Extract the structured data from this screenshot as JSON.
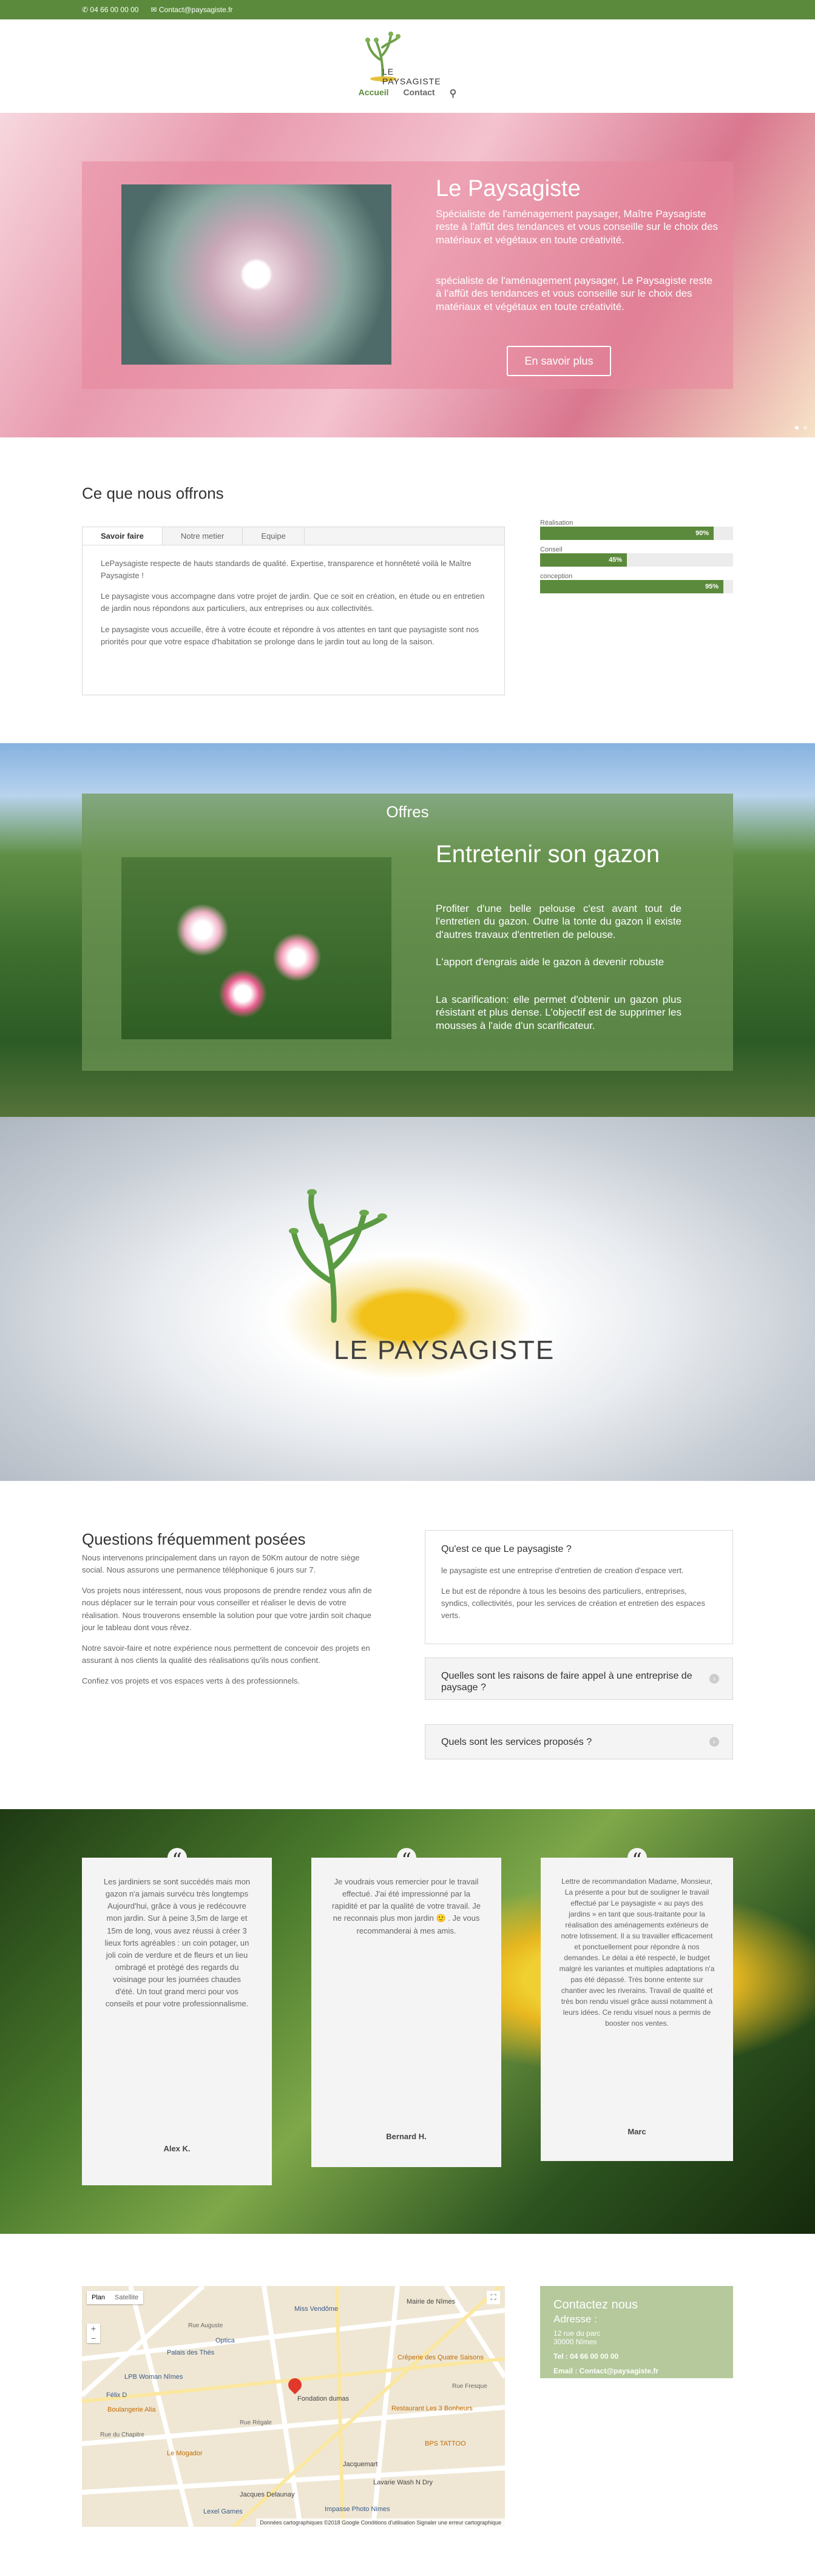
{
  "topbar": {
    "phone": "04 66 00 00 00",
    "email": "Contact@paysagiste.fr"
  },
  "logo": {
    "text": "LE PAYSAGISTE"
  },
  "nav": {
    "items": [
      "Accueil",
      "Contact"
    ]
  },
  "hero": {
    "title": "Le Paysagiste",
    "p1": "Spécialiste de l'aménagement paysager, Maître Paysagiste reste à l'affût des tendances et vous conseille sur le choix des matériaux et végétaux en toute créativité.",
    "p2": "spécialiste de l'aménagement paysager, Le Paysagiste reste à l'affût des tendances et vous conseille sur le choix des matériaux et végétaux en toute créativité.",
    "button": "En savoir plus"
  },
  "offer": {
    "title": "Ce que nous offrons",
    "tabs": [
      "Savoir faire",
      "Notre metier",
      "Equipe"
    ],
    "p1": "LePaysagiste respecte de hauts standards de qualité. Expertise, transparence et honnêteté voilà le Maître Paysagiste !",
    "p2": "Le paysagiste vous accompagne dans votre projet de jardin. Que ce soit en création, en étude ou en entretien de jardin nous répondons aux particuliers, aux entreprises ou aux collectivités.",
    "p3": "Le paysagiste vous accueille, être à votre écoute et répondre à vos attentes en tant que paysagiste sont nos priorités pour que votre espace d'habitation se prolonge dans le jardin tout au long de la saison."
  },
  "bars": [
    {
      "label": "Réalisation",
      "value": 90,
      "text": "90%"
    },
    {
      "label": "Conseil",
      "value": 45,
      "text": "45%"
    },
    {
      "label": "conception",
      "value": 95,
      "text": "95%"
    }
  ],
  "offres": {
    "title": "Offres",
    "heading": "Entretenir son gazon",
    "p1": "Profiter d'une belle pelouse c'est avant tout de l'entretien du gazon. Outre la tonte du gazon il existe d'autres travaux d'entretien de pelouse.",
    "p2": "L'apport d'engrais aide le gazon à devenir robuste",
    "p3": "La scarification: elle permet d'obtenir un gazon plus résistant et plus dense. L'objectif est de supprimer les mousses à l'aide d'un scarificateur."
  },
  "banner": {
    "logo_text": "LE PAYSAGISTE"
  },
  "faq": {
    "title": "Questions fréquemment posées",
    "p1": "Nous intervenons principalement dans un rayon de 50Km autour de notre siège social. Nous assurons une permanence téléphonique 6 jours sur 7.",
    "p2": "Vos projets nous intéressent, nous vous proposons de prendre rendez vous afin de nous déplacer sur le terrain pour vous conseiller et réaliser le devis de votre réalisation. Nous trouverons ensemble la solution pour que votre jardin soit chaque jour le tableau dont vous rêvez.",
    "p3": "Notre savoir-faire et notre expérience nous permettent de concevoir des projets en assurant à nos clients la qualité des réalisations qu'ils nous confient.",
    "p4": "Confiez vos projets et vos espaces verts à des professionnels.",
    "items": [
      {
        "q": "Qu'est ce que Le paysagiste ?",
        "a1": "le paysagiste est une entreprise d'entretien de creation d'espace vert.",
        "a2": "Le but est de répondre à tous les besoins des particuliers, entreprises, syndics, collectivités, pour les services de création et entretien des espaces verts."
      },
      {
        "q": "Quelles sont les raisons de faire appel à une entreprise de paysage ?"
      },
      {
        "q": "Quels sont les services proposés ?"
      }
    ]
  },
  "testimonials": [
    {
      "text": "Les jardiniers se sont succédés mais mon gazon n'a jamais survécu très longtemps Aujourd'hui, grâce à vous je redécouvre mon jardin. Sur à peine 3,5m de large et 15m de long, vous avez réussi à créer 3 lieux forts agréables : un coin potager, un joli coin de verdure et de fleurs et un lieu ombragé et protégé des regards du voisinage pour les journées chaudes d'été. Un tout grand merci pour vos conseils et pour votre professionnalisme.",
      "author": "Alex K."
    },
    {
      "text": "Je voudrais vous remercier pour le travail effectué. J'ai été impressionné par la rapidité et par la qualité de votre travail. Je ne reconnais plus mon jardin 🙂 . Je vous recommanderai à mes amis.",
      "author": "Bernard H."
    },
    {
      "text": "Lettre de recommandation Madame, Monsieur, La présente a pour but de souligner le travail effectué par Le paysagiste « au pays des jardins » en tant que sous-traitante pour la réalisation des aménagements extérieurs de notre lotissement. Il a su travailler efficacement et ponctuellement pour répondre à nos demandes. Le délai a été respecté, le budget malgré les variantes et multiples adaptations n'a pas été dépassé. Très bonne entente sur chantier avec les riverains. Travail de qualité et très bon rendu visuel grâce aussi notamment à leurs idées. Ce rendu visuel nous a permis de booster nos ventes.",
      "author": "Marc"
    }
  ],
  "map": {
    "mode_plan": "Plan",
    "mode_sat": "Satellite",
    "zoom_in": "+",
    "zoom_out": "−",
    "footer": "Données cartographiques ©2018 Google   Conditions d'utilisation   Signaler une erreur cartographique",
    "places": [
      "Mairie de Nîmes",
      "Miss Vendôme",
      "Optica",
      "Palais des Thés",
      "LPB Woman Nîmes",
      "Félix D",
      "Boulangerie Alia",
      "Le Mogador",
      "Fondation dumas",
      "Crêperie des Quatre Saisons",
      "Restaurant Les 3 Bonheurs",
      "BPS TATTOO",
      "Jacquemart",
      "Lavarie Wash N Dry",
      "Jacques Delaunay",
      "Lexel Games",
      "Impasse Photo Nimes",
      "Rue Auguste",
      "Rue du Chapitre",
      "Rue Fresque",
      "Rue Régale"
    ]
  },
  "contact": {
    "title": "Contactez nous",
    "address_label": "Adresse :",
    "address1": "12 rue du parc",
    "address2": "30000 Nîmes",
    "tel": "Tel : 04 66 00 00 00",
    "email": "Email : Contact@paysagiste.fr"
  },
  "colors": {
    "accent": "#5b8a3c",
    "contact_bg": "#b5c99c"
  }
}
